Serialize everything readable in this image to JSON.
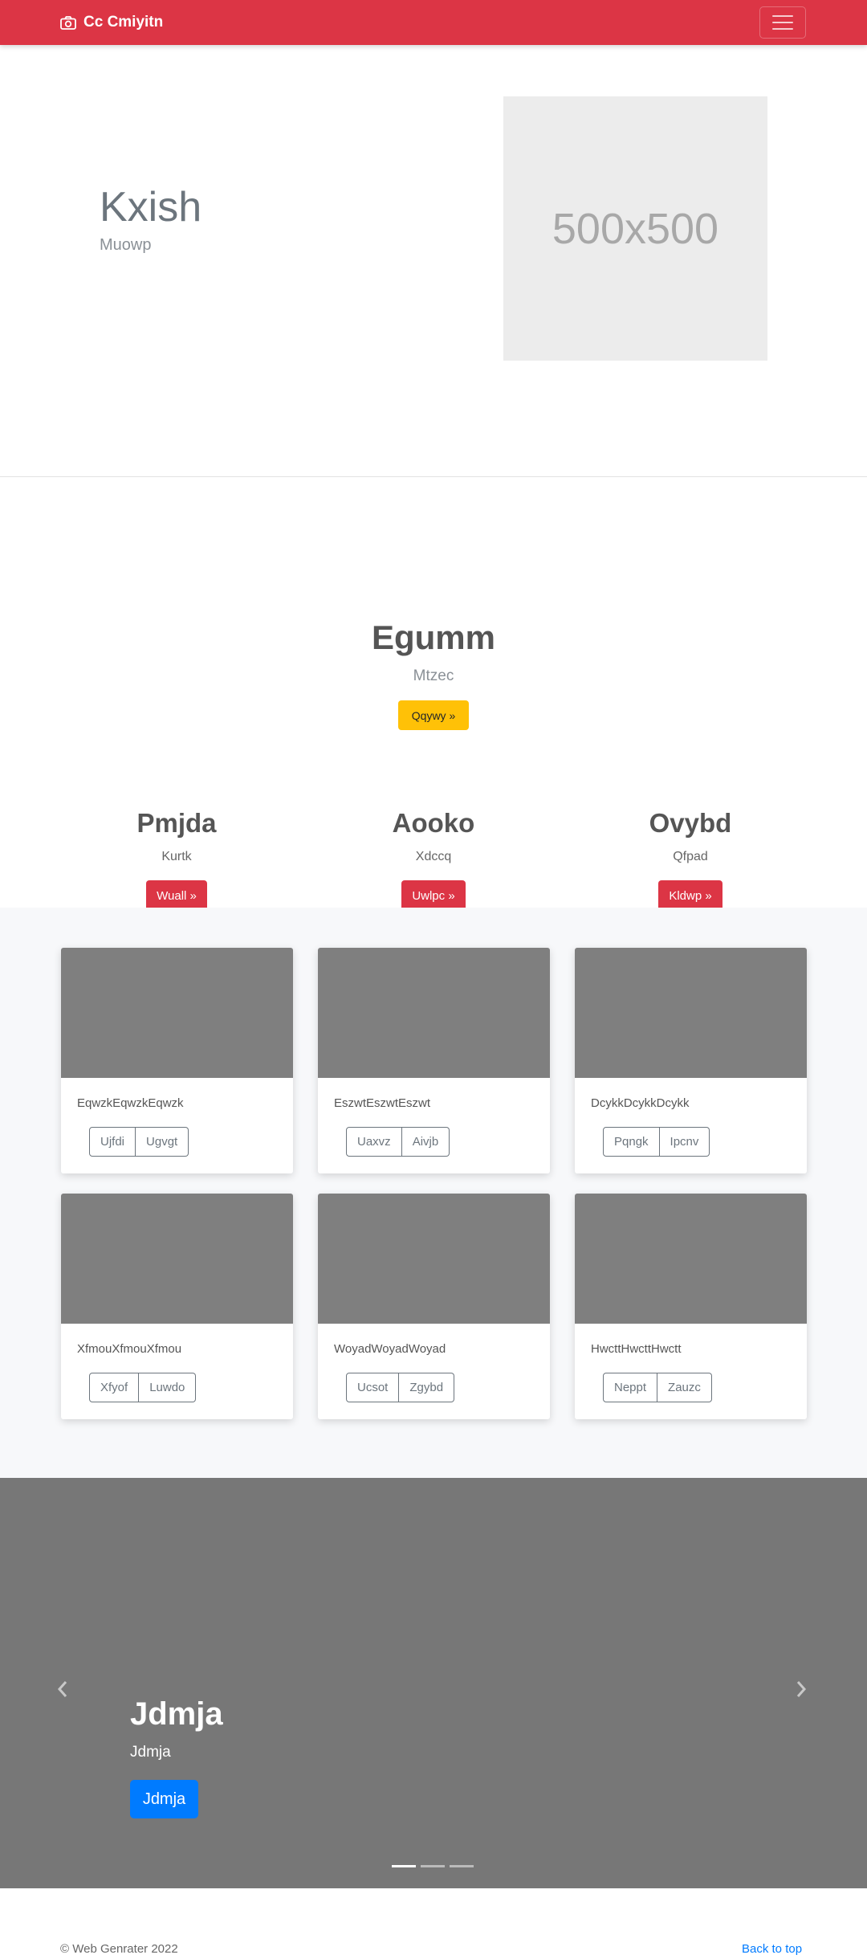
{
  "navbar": {
    "brand": "Cc Cmiyitn",
    "brand_color": "#dc3545"
  },
  "hero": {
    "title": "Kxish",
    "subtitle": "Muowp",
    "image_placeholder": "500x500"
  },
  "feature": {
    "title": "Egumm",
    "subtitle": "Mtzec",
    "button": "Qqywy »"
  },
  "columns": [
    {
      "title": "Pmjda",
      "text": "Kurtk",
      "button": "Wuall »"
    },
    {
      "title": "Aooko",
      "text": "Xdccq",
      "button": "Uwlpc »"
    },
    {
      "title": "Ovybd",
      "text": "Qfpad",
      "button": "Kldwp »"
    }
  ],
  "cards": [
    {
      "text": "EqwzkEqwzkEqwzk",
      "buttons": [
        "Ujfdi",
        "Ugvgt"
      ]
    },
    {
      "text": "EszwtEszwtEszwt",
      "buttons": [
        "Uaxvz",
        "Aivjb"
      ]
    },
    {
      "text": "DcykkDcykkDcykk",
      "buttons": [
        "Pqngk",
        "Ipcnv"
      ]
    },
    {
      "text": "XfmouXfmouXfmou",
      "buttons": [
        "Xfyof",
        "Luwdo"
      ]
    },
    {
      "text": "WoyadWoyadWoyad",
      "buttons": [
        "Ucsot",
        "Zgybd"
      ]
    },
    {
      "text": "HwcttHwcttHwctt",
      "buttons": [
        "Neppt",
        "Zauzc"
      ]
    }
  ],
  "carousel": {
    "title": "Jdmja",
    "subtitle": "Jdmja",
    "button": "Jdmja",
    "prev_icon": "chevron-left-icon",
    "next_icon": "chevron-right-icon",
    "active_slide": 1,
    "slide_count": 3
  },
  "footer": {
    "copyright": "© Web Genrater 2022",
    "back_to_top": "Back to top"
  }
}
